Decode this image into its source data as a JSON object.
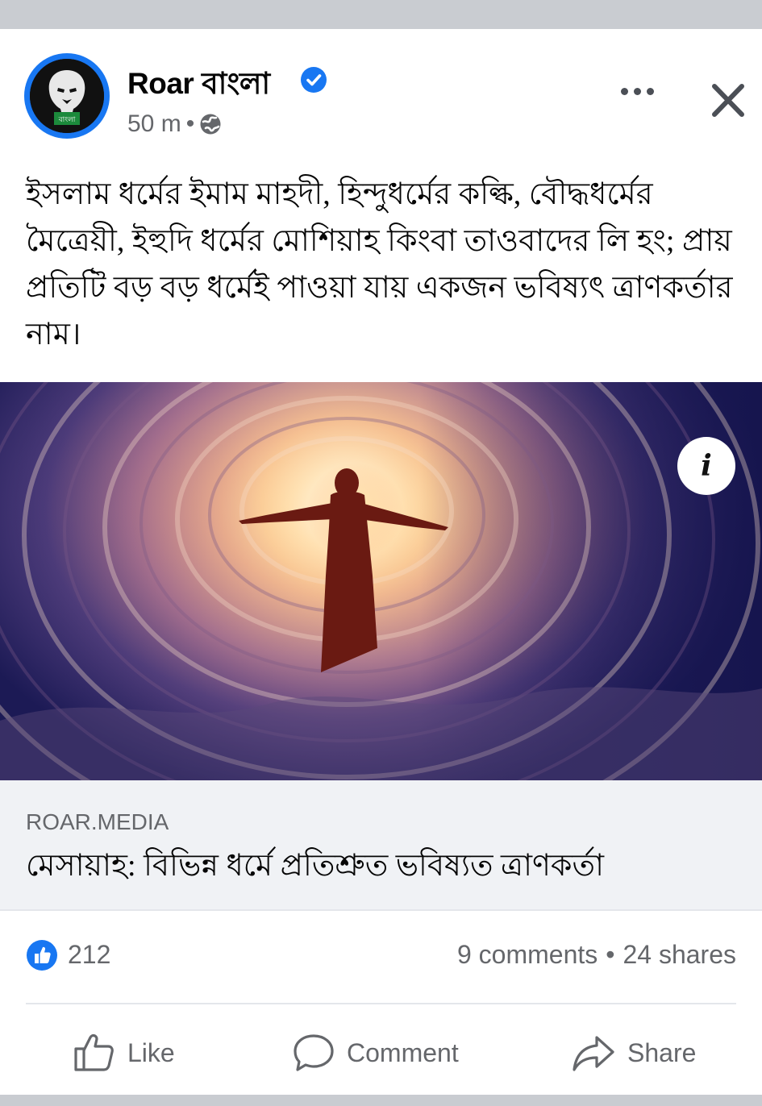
{
  "post": {
    "page_name": "Roar বাংলা",
    "avatar_badge": "বাংলা",
    "time": "50 m",
    "separator": "•",
    "text": "ইসলাম ধর্মের ইমাম মাহদী, হিন্দুধর্মের কল্কি, বৌদ্ধধর্মের মৈত্রেয়ী, ইহুদি ধর্মের মোশিয়াহ কিংবা তাওবাদের লি হং; প্রায় প্রতিটি বড় বড় ধর্মেই পাওয়া যায় একজন ভবিষ্যৎ ত্রাণকর্তার নাম।",
    "icons": {
      "verified": "verified-badge-icon",
      "privacy": "globe-icon",
      "more": "more-options-icon",
      "close": "close-icon",
      "info": "info-icon"
    },
    "info_label": "i"
  },
  "link": {
    "domain": "ROAR.MEDIA",
    "title": "মেসায়াহ: বিভিন্ন ধর্মে প্রতিশ্রুত ভবিষ্যত ত্রাণকর্তা"
  },
  "stats": {
    "reactions": "212",
    "comments": "9 comments",
    "dot": "•",
    "shares": "24 shares"
  },
  "actions": {
    "like": "Like",
    "comment": "Comment",
    "share": "Share"
  },
  "colors": {
    "brand_blue": "#1877f2",
    "secondary_text": "#65676b",
    "link_bg": "#f0f2f5"
  }
}
